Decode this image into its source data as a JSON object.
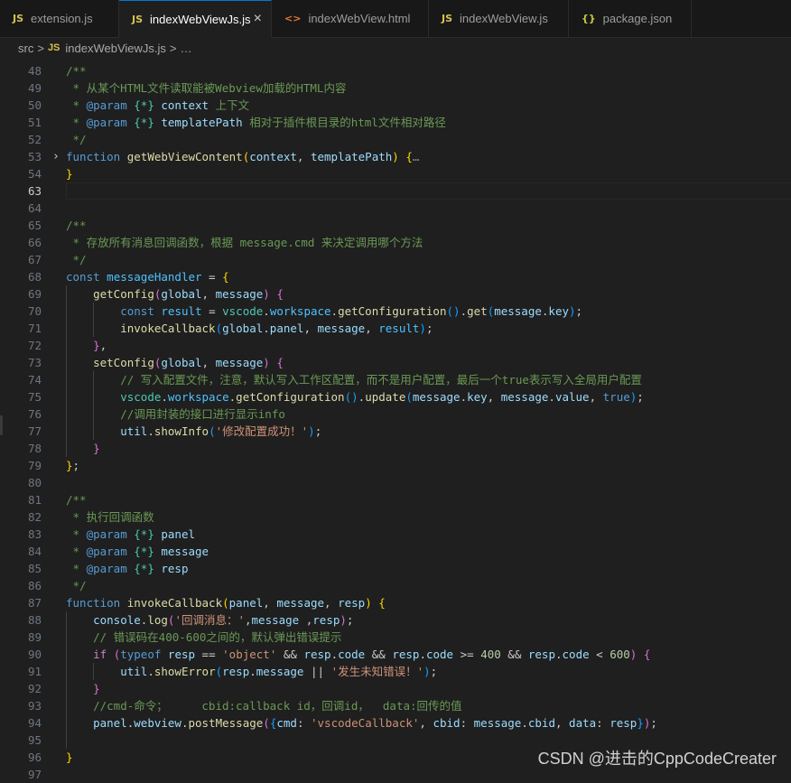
{
  "tabs": [
    {
      "icon": "JS",
      "label": "extension.js",
      "type": "js",
      "active": false
    },
    {
      "icon": "JS",
      "label": "indexWebViewJs.js",
      "type": "js",
      "active": true
    },
    {
      "icon": "<>",
      "label": "indexWebView.html",
      "type": "html",
      "active": false
    },
    {
      "icon": "JS",
      "label": "indexWebView.js",
      "type": "js",
      "active": false
    },
    {
      "icon": "{}",
      "label": "package.json",
      "type": "json",
      "active": false
    }
  ],
  "close_symbol": "×",
  "breadcrumb": {
    "folder": "src",
    "sep": ">",
    "file_icon": "JS",
    "file": "indexWebViewJs.js",
    "ellipsis": "…"
  },
  "current_line": 63,
  "folded_line": 53,
  "lines": [
    {
      "n": 48,
      "t": [
        [
          "/**",
          "com"
        ]
      ]
    },
    {
      "n": 49,
      "t": [
        [
          " * 从某个HTML文件读取能被Webview加载的HTML内容",
          "com"
        ]
      ]
    },
    {
      "n": 50,
      "t": [
        [
          " * ",
          "com"
        ],
        [
          "@param",
          "kw"
        ],
        [
          " ",
          "com"
        ],
        [
          "{*}",
          "type"
        ],
        [
          " ",
          "com"
        ],
        [
          "context",
          "var"
        ],
        [
          " 上下文",
          "com"
        ]
      ]
    },
    {
      "n": 51,
      "t": [
        [
          " * ",
          "com"
        ],
        [
          "@param",
          "kw"
        ],
        [
          " ",
          "com"
        ],
        [
          "{*}",
          "type"
        ],
        [
          " ",
          "com"
        ],
        [
          "templatePath",
          "var"
        ],
        [
          " 相对于插件根目录的html文件相对路径",
          "com"
        ]
      ]
    },
    {
      "n": 52,
      "t": [
        [
          " */",
          "com"
        ]
      ]
    },
    {
      "n": 53,
      "t": [
        [
          "function",
          "kw"
        ],
        [
          " ",
          ""
        ],
        [
          "getWebViewContent",
          "fn"
        ],
        [
          "(",
          "b1"
        ],
        [
          "context",
          "var"
        ],
        [
          ", ",
          ""
        ],
        [
          "templatePath",
          "var"
        ],
        [
          ")",
          "b1"
        ],
        [
          " ",
          ""
        ],
        [
          "{",
          "b1"
        ],
        [
          "…",
          "dim"
        ]
      ]
    },
    {
      "n": 54,
      "t": [
        [
          "}",
          "b1"
        ]
      ]
    },
    {
      "n": 63,
      "t": []
    },
    {
      "n": 64,
      "t": []
    },
    {
      "n": 65,
      "t": [
        [
          "/**",
          "com"
        ]
      ]
    },
    {
      "n": 66,
      "t": [
        [
          " * 存放所有消息回调函数，根据 message.cmd 来决定调用哪个方法",
          "com"
        ]
      ]
    },
    {
      "n": 67,
      "t": [
        [
          " */",
          "com"
        ]
      ]
    },
    {
      "n": 68,
      "t": [
        [
          "const",
          "kw"
        ],
        [
          " ",
          ""
        ],
        [
          "messageHandler",
          "const"
        ],
        [
          " = ",
          ""
        ],
        [
          "{",
          "b1"
        ]
      ]
    },
    {
      "n": 69,
      "t": [
        [
          "    ",
          ""
        ],
        [
          "getConfig",
          "fn"
        ],
        [
          "(",
          "b2"
        ],
        [
          "global",
          "var"
        ],
        [
          ", ",
          ""
        ],
        [
          "message",
          "var"
        ],
        [
          ")",
          "b2"
        ],
        [
          " ",
          ""
        ],
        [
          "{",
          "b2"
        ]
      ]
    },
    {
      "n": 70,
      "t": [
        [
          "        ",
          ""
        ],
        [
          "const",
          "kw"
        ],
        [
          " ",
          ""
        ],
        [
          "result",
          "const"
        ],
        [
          " = ",
          ""
        ],
        [
          "vscode",
          "type"
        ],
        [
          ".",
          ""
        ],
        [
          "workspace",
          "const"
        ],
        [
          ".",
          ""
        ],
        [
          "getConfiguration",
          "fn"
        ],
        [
          "()",
          "b3"
        ],
        [
          ".",
          ""
        ],
        [
          "get",
          "fn"
        ],
        [
          "(",
          "b3"
        ],
        [
          "message",
          "var"
        ],
        [
          ".",
          ""
        ],
        [
          "key",
          "var"
        ],
        [
          ")",
          "b3"
        ],
        [
          ";",
          ""
        ]
      ]
    },
    {
      "n": 71,
      "t": [
        [
          "        ",
          ""
        ],
        [
          "invokeCallback",
          "fn"
        ],
        [
          "(",
          "b3"
        ],
        [
          "global",
          "var"
        ],
        [
          ".",
          ""
        ],
        [
          "panel",
          "var"
        ],
        [
          ", ",
          ""
        ],
        [
          "message",
          "var"
        ],
        [
          ", ",
          ""
        ],
        [
          "result",
          "const"
        ],
        [
          ")",
          "b3"
        ],
        [
          ";",
          ""
        ]
      ]
    },
    {
      "n": 72,
      "t": [
        [
          "    ",
          ""
        ],
        [
          "}",
          "b2"
        ],
        [
          ",",
          ""
        ]
      ]
    },
    {
      "n": 73,
      "t": [
        [
          "    ",
          ""
        ],
        [
          "setConfig",
          "fn"
        ],
        [
          "(",
          "b2"
        ],
        [
          "global",
          "var"
        ],
        [
          ", ",
          ""
        ],
        [
          "message",
          "var"
        ],
        [
          ")",
          "b2"
        ],
        [
          " ",
          ""
        ],
        [
          "{",
          "b2"
        ]
      ]
    },
    {
      "n": 74,
      "t": [
        [
          "        ",
          ""
        ],
        [
          "// 写入配置文件，注意，默认写入工作区配置，而不是用户配置，最后一个true表示写入全局用户配置",
          "com"
        ]
      ]
    },
    {
      "n": 75,
      "t": [
        [
          "        ",
          ""
        ],
        [
          "vscode",
          "type"
        ],
        [
          ".",
          ""
        ],
        [
          "workspace",
          "const"
        ],
        [
          ".",
          ""
        ],
        [
          "getConfiguration",
          "fn"
        ],
        [
          "()",
          "b3"
        ],
        [
          ".",
          ""
        ],
        [
          "update",
          "fn"
        ],
        [
          "(",
          "b3"
        ],
        [
          "message",
          "var"
        ],
        [
          ".",
          ""
        ],
        [
          "key",
          "var"
        ],
        [
          ", ",
          ""
        ],
        [
          "message",
          "var"
        ],
        [
          ".",
          ""
        ],
        [
          "value",
          "var"
        ],
        [
          ", ",
          ""
        ],
        [
          "true",
          "kw"
        ],
        [
          ")",
          "b3"
        ],
        [
          ";",
          ""
        ]
      ]
    },
    {
      "n": 76,
      "t": [
        [
          "        ",
          ""
        ],
        [
          "//调用封装的接口进行显示info",
          "com"
        ]
      ]
    },
    {
      "n": 77,
      "t": [
        [
          "        ",
          ""
        ],
        [
          "util",
          "var"
        ],
        [
          ".",
          ""
        ],
        [
          "showInfo",
          "fn"
        ],
        [
          "(",
          "b3"
        ],
        [
          "'修改配置成功！'",
          "str"
        ],
        [
          ")",
          "b3"
        ],
        [
          ";",
          ""
        ]
      ]
    },
    {
      "n": 78,
      "t": [
        [
          "    ",
          ""
        ],
        [
          "}",
          "b2"
        ]
      ]
    },
    {
      "n": 79,
      "t": [
        [
          "}",
          "b1"
        ],
        [
          ";",
          ""
        ]
      ]
    },
    {
      "n": 80,
      "t": []
    },
    {
      "n": 81,
      "t": [
        [
          "/**",
          "com"
        ]
      ]
    },
    {
      "n": 82,
      "t": [
        [
          " * 执行回调函数",
          "com"
        ]
      ]
    },
    {
      "n": 83,
      "t": [
        [
          " * ",
          "com"
        ],
        [
          "@param",
          "kw"
        ],
        [
          " ",
          "com"
        ],
        [
          "{*}",
          "type"
        ],
        [
          " ",
          "com"
        ],
        [
          "panel",
          "var"
        ]
      ]
    },
    {
      "n": 84,
      "t": [
        [
          " * ",
          "com"
        ],
        [
          "@param",
          "kw"
        ],
        [
          " ",
          "com"
        ],
        [
          "{*}",
          "type"
        ],
        [
          " ",
          "com"
        ],
        [
          "message",
          "var"
        ]
      ]
    },
    {
      "n": 85,
      "t": [
        [
          " * ",
          "com"
        ],
        [
          "@param",
          "kw"
        ],
        [
          " ",
          "com"
        ],
        [
          "{*}",
          "type"
        ],
        [
          " ",
          "com"
        ],
        [
          "resp",
          "var"
        ]
      ]
    },
    {
      "n": 86,
      "t": [
        [
          " */",
          "com"
        ]
      ]
    },
    {
      "n": 87,
      "t": [
        [
          "function",
          "kw"
        ],
        [
          " ",
          ""
        ],
        [
          "invokeCallback",
          "fn"
        ],
        [
          "(",
          "b1"
        ],
        [
          "panel",
          "var"
        ],
        [
          ", ",
          ""
        ],
        [
          "message",
          "var"
        ],
        [
          ", ",
          ""
        ],
        [
          "resp",
          "var"
        ],
        [
          ")",
          "b1"
        ],
        [
          " ",
          ""
        ],
        [
          "{",
          "b1"
        ]
      ]
    },
    {
      "n": 88,
      "t": [
        [
          "    ",
          ""
        ],
        [
          "console",
          "var"
        ],
        [
          ".",
          ""
        ],
        [
          "log",
          "fn"
        ],
        [
          "(",
          "b2"
        ],
        [
          "'回调消息：'",
          "str"
        ],
        [
          ",",
          ""
        ],
        [
          "message",
          "var"
        ],
        [
          " ,",
          ""
        ],
        [
          "resp",
          "var"
        ],
        [
          ")",
          "b2"
        ],
        [
          ";",
          ""
        ]
      ]
    },
    {
      "n": 89,
      "t": [
        [
          "    ",
          ""
        ],
        [
          "// 错误码在400-600之间的，默认弹出错误提示",
          "com"
        ]
      ]
    },
    {
      "n": 90,
      "t": [
        [
          "    ",
          ""
        ],
        [
          "if",
          "ctl"
        ],
        [
          " ",
          ""
        ],
        [
          "(",
          "b2"
        ],
        [
          "typeof",
          "kw"
        ],
        [
          " ",
          ""
        ],
        [
          "resp",
          "var"
        ],
        [
          " == ",
          ""
        ],
        [
          "'object'",
          "str"
        ],
        [
          " && ",
          ""
        ],
        [
          "resp",
          "var"
        ],
        [
          ".",
          ""
        ],
        [
          "code",
          "var"
        ],
        [
          " && ",
          ""
        ],
        [
          "resp",
          "var"
        ],
        [
          ".",
          ""
        ],
        [
          "code",
          "var"
        ],
        [
          " >= ",
          ""
        ],
        [
          "400",
          "num"
        ],
        [
          " && ",
          ""
        ],
        [
          "resp",
          "var"
        ],
        [
          ".",
          ""
        ],
        [
          "code",
          "var"
        ],
        [
          " < ",
          ""
        ],
        [
          "600",
          "num"
        ],
        [
          ")",
          "b2"
        ],
        [
          " ",
          ""
        ],
        [
          "{",
          "b2"
        ]
      ]
    },
    {
      "n": 91,
      "t": [
        [
          "        ",
          ""
        ],
        [
          "util",
          "var"
        ],
        [
          ".",
          ""
        ],
        [
          "showError",
          "fn"
        ],
        [
          "(",
          "b3"
        ],
        [
          "resp",
          "var"
        ],
        [
          ".",
          ""
        ],
        [
          "message",
          "var"
        ],
        [
          " || ",
          ""
        ],
        [
          "'发生未知错误！'",
          "str"
        ],
        [
          ")",
          "b3"
        ],
        [
          ";",
          ""
        ]
      ]
    },
    {
      "n": 92,
      "t": [
        [
          "    ",
          ""
        ],
        [
          "}",
          "b2"
        ]
      ]
    },
    {
      "n": 93,
      "t": [
        [
          "    ",
          ""
        ],
        [
          "//cmd-命令；     cbid:callback id，回调id，  data:回传的值",
          "com"
        ]
      ]
    },
    {
      "n": 94,
      "t": [
        [
          "    ",
          ""
        ],
        [
          "panel",
          "var"
        ],
        [
          ".",
          ""
        ],
        [
          "webview",
          "var"
        ],
        [
          ".",
          ""
        ],
        [
          "postMessage",
          "fn"
        ],
        [
          "(",
          "b2"
        ],
        [
          "{",
          "b3"
        ],
        [
          "cmd",
          "var"
        ],
        [
          ": ",
          ""
        ],
        [
          "'vscodeCallback'",
          "str"
        ],
        [
          ", ",
          ""
        ],
        [
          "cbid",
          "var"
        ],
        [
          ": ",
          ""
        ],
        [
          "message",
          "var"
        ],
        [
          ".",
          ""
        ],
        [
          "cbid",
          "var"
        ],
        [
          ", ",
          ""
        ],
        [
          "data",
          "var"
        ],
        [
          ": ",
          ""
        ],
        [
          "resp",
          "var"
        ],
        [
          "}",
          "b3"
        ],
        [
          ")",
          "b2"
        ],
        [
          ";",
          ""
        ]
      ]
    },
    {
      "n": 95,
      "t": []
    },
    {
      "n": 96,
      "t": [
        [
          "}",
          "b1"
        ]
      ]
    },
    {
      "n": 97,
      "t": []
    }
  ],
  "watermark": "CSDN @进击的CppCodeCreater"
}
